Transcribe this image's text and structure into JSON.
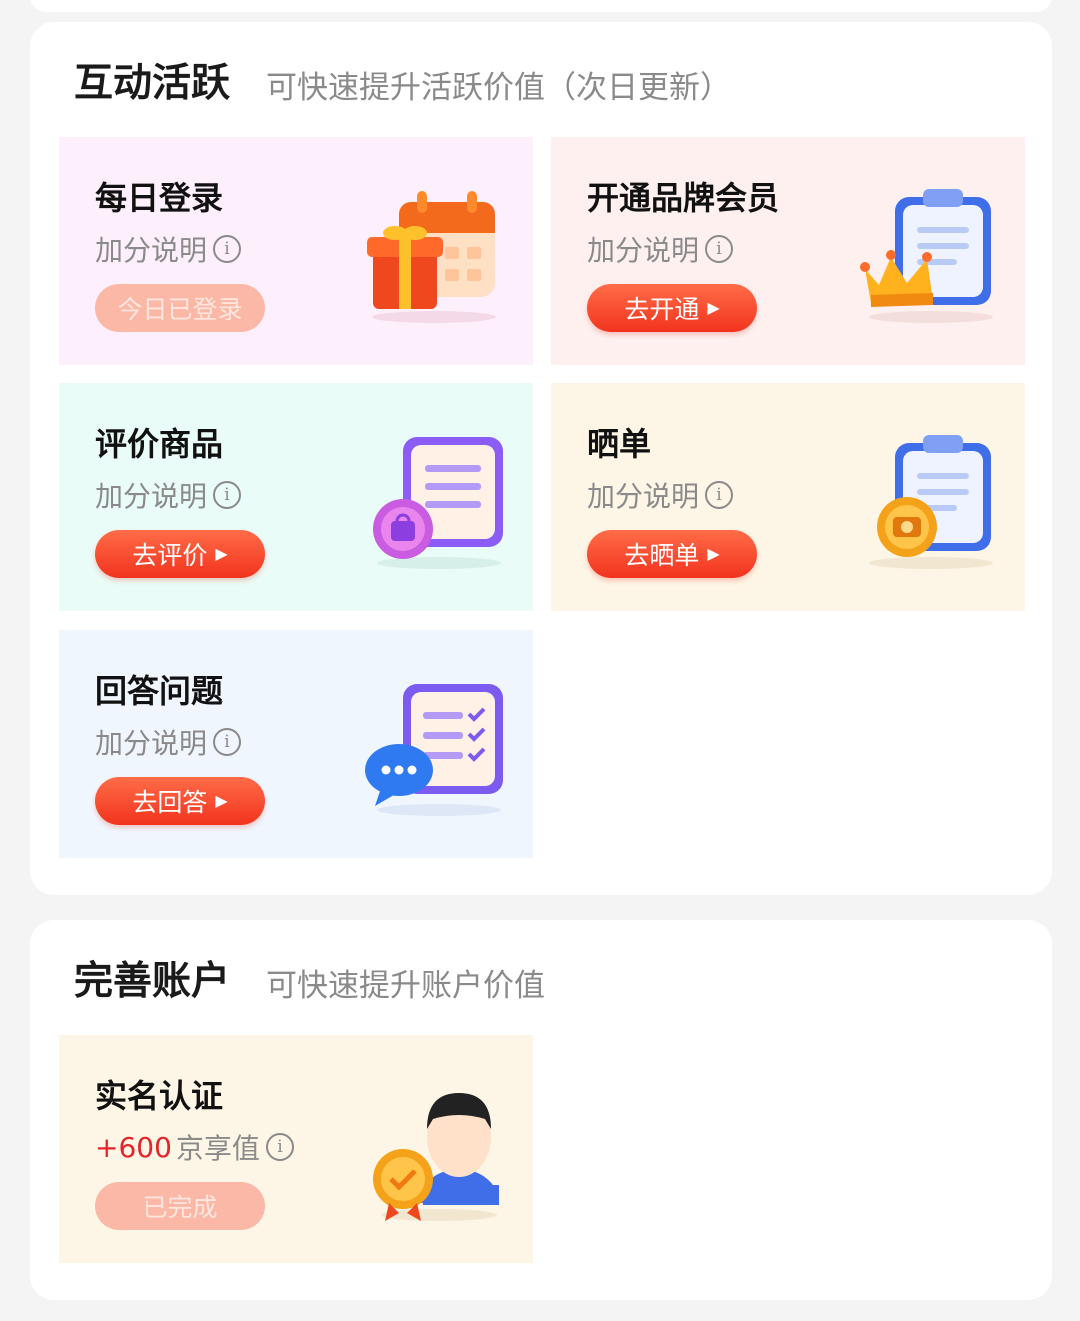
{
  "interaction_section": {
    "title": "互动活跃",
    "subtitle": "可快速提升活跃价值（次日更新）",
    "cards": [
      {
        "title": "每日登录",
        "desc": "加分说明",
        "button": "今日已登录",
        "button_state": "disabled",
        "bg_color": "#fdeffb",
        "icon": "calendar-gift-icon"
      },
      {
        "title": "开通品牌会员",
        "desc": "加分说明",
        "button": "去开通",
        "button_state": "active",
        "bg_color": "#fdf0ef",
        "icon": "clipboard-crown-icon"
      },
      {
        "title": "评价商品",
        "desc": "加分说明",
        "button": "去评价",
        "button_state": "active",
        "bg_color": "#eafcf8",
        "icon": "document-bag-icon"
      },
      {
        "title": "晒单",
        "desc": "加分说明",
        "button": "去晒单",
        "button_state": "active",
        "bg_color": "#fdf5e6",
        "icon": "clipboard-camera-icon"
      },
      {
        "title": "回答问题",
        "desc": "加分说明",
        "button": "去回答",
        "button_state": "active",
        "bg_color": "#f0f6fe",
        "icon": "checklist-chat-icon"
      }
    ]
  },
  "account_section": {
    "title": "完善账户",
    "subtitle": "可快速提升账户价值",
    "cards": [
      {
        "title": "实名认证",
        "points": "+600",
        "desc": "京享值",
        "button": "已完成",
        "button_state": "disabled",
        "bg_color": "#fdf5e6",
        "icon": "user-badge-icon"
      }
    ]
  },
  "colors": {
    "accent": "#f2331e",
    "points_red": "#e5242a",
    "disabled_button": "#fbb8a6"
  }
}
